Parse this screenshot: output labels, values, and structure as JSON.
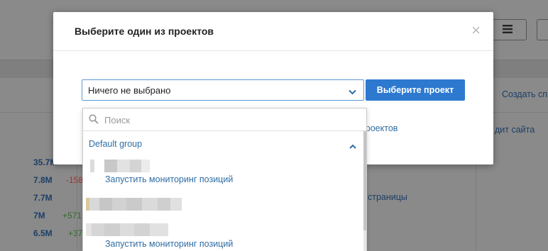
{
  "background": {
    "top_right_links": [
      "Создать спи",
      "дит сайта",
      "страницы"
    ],
    "metrics": [
      {
        "value": "35.7M",
        "delta": ""
      },
      {
        "value": "7.8M",
        "delta": "-158"
      },
      {
        "value": "7.7M",
        "delta": ""
      },
      {
        "value": "7M",
        "delta": "+571"
      },
      {
        "value": "6.5M",
        "delta": "+37"
      }
    ]
  },
  "modal": {
    "title": "Выберите один из проектов",
    "close_glyph": "×",
    "select": {
      "value": "Ничего не выбрано"
    },
    "choose_button": "Выберите проект",
    "link_partial": "проектов"
  },
  "dropdown": {
    "search_placeholder": "Поиск",
    "group": {
      "label": "Default group"
    },
    "items": [
      {
        "action": "Запустить мониторинг позиций"
      },
      {
        "action": ""
      },
      {
        "action": "Запустить мониторинг позиций"
      }
    ]
  },
  "colors": {
    "accent": "#2d79d0",
    "link": "#2e6da4"
  }
}
